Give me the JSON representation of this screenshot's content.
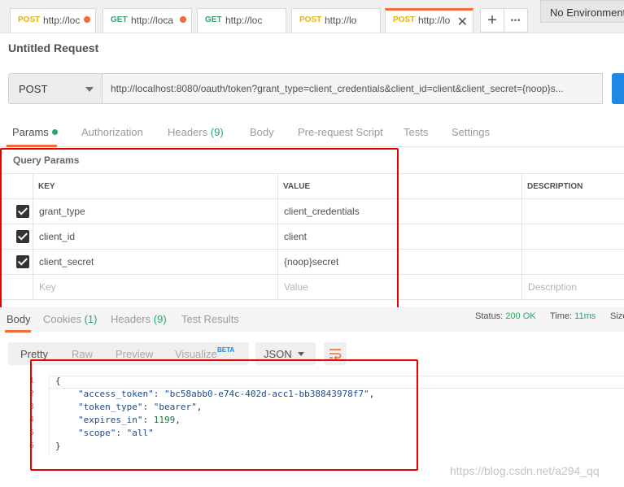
{
  "tabs": [
    {
      "method": "POST",
      "url": "http://loc",
      "dirty": true
    },
    {
      "method": "GET",
      "url": "http://loca",
      "dirty": true
    },
    {
      "method": "GET",
      "url": "http://loc",
      "dirty": false
    },
    {
      "method": "POST",
      "url": "http://lo",
      "dirty": false
    },
    {
      "method": "POST",
      "url": "http://lo",
      "dirty": false,
      "active": true
    }
  ],
  "tab_controls": {
    "add_symbol": "+",
    "more_symbol": "•••"
  },
  "environment": {
    "label": "No Environment"
  },
  "request": {
    "title": "Untitled Request",
    "method": "POST",
    "url": "http://localhost:8080/oauth/token?grant_type=client_credentials&client_id=client&client_secret={noop}s..."
  },
  "request_tabs": {
    "params": "Params",
    "authorization": "Authorization",
    "headers": "Headers",
    "headers_count": "(9)",
    "body": "Body",
    "prerequest": "Pre-request Script",
    "tests": "Tests",
    "settings": "Settings"
  },
  "query_params": {
    "section_label": "Query Params",
    "headers": {
      "key": "KEY",
      "value": "VALUE",
      "description": "DESCRIPTION"
    },
    "rows": [
      {
        "checked": true,
        "key": "grant_type",
        "value": "client_credentials"
      },
      {
        "checked": true,
        "key": "client_id",
        "value": "client"
      },
      {
        "checked": true,
        "key": "client_secret",
        "value": "{noop}secret"
      }
    ],
    "placeholder": {
      "key": "Key",
      "value": "Value",
      "description": "Description"
    }
  },
  "response_tabs": {
    "body": "Body",
    "cookies": "Cookies",
    "cookies_count": "(1)",
    "headers": "Headers",
    "headers_count": "(9)",
    "test_results": "Test Results"
  },
  "status": {
    "status_label": "Status:",
    "status_value": "200 OK",
    "time_label": "Time:",
    "time_value": "11ms",
    "size_label": "Size"
  },
  "format_tabs": {
    "pretty": "Pretty",
    "raw": "Raw",
    "preview": "Preview",
    "visualize": "Visualize",
    "beta": "BETA"
  },
  "response_format": {
    "selected": "JSON"
  },
  "response_body": {
    "line_numbers": [
      "1",
      "2",
      "3",
      "4",
      "5",
      "6"
    ],
    "open": "{",
    "close": "}",
    "fields": [
      {
        "key": "\"access_token\"",
        "value": "\"bc58abb0-e74c-402d-acc1-bb38843978f7\"",
        "comma": ","
      },
      {
        "key": "\"token_type\"",
        "value": "\"bearer\"",
        "comma": ","
      },
      {
        "key": "\"expires_in\"",
        "value": "1199",
        "comma": ","
      },
      {
        "key": "\"scope\"",
        "value": "\"all\"",
        "comma": ""
      }
    ]
  },
  "watermark": "https://blog.csdn.net/a294_qq",
  "colors": {
    "accent": "#f26b3a",
    "green": "#2aa56b",
    "send_blue": "#1e88e5",
    "annotation_red": "#e60000"
  }
}
